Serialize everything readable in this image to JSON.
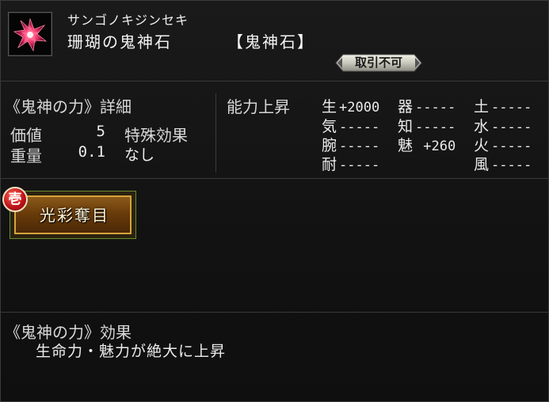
{
  "header": {
    "furigana": "サンゴノキジンセキ",
    "item_name": "珊瑚の鬼神石",
    "item_type": "【鬼神石】",
    "trade_status": "取引不可",
    "item_icon": "red-crystal-flower-icon"
  },
  "details": {
    "title": "《鬼神の力》詳細",
    "value_label": "価値",
    "value": "5",
    "special_effect_label": "特殊効果",
    "weight_label": "重量",
    "weight": "0.1",
    "special_effect_value": "なし"
  },
  "ability": {
    "title": "能力上昇",
    "stats": [
      {
        "name": "生",
        "value": "+2000"
      },
      {
        "name": "器",
        "value": "-----"
      },
      {
        "name": "土",
        "value": "-----"
      },
      {
        "name": "気",
        "value": "-----"
      },
      {
        "name": "知",
        "value": "-----"
      },
      {
        "name": "水",
        "value": "-----"
      },
      {
        "name": "腕",
        "value": "-----"
      },
      {
        "name": "魅",
        "value": " +260"
      },
      {
        "name": "火",
        "value": "-----"
      },
      {
        "name": "耐",
        "value": "-----"
      },
      {
        "name": "風",
        "value": "-----"
      }
    ]
  },
  "skill": {
    "rank_badge": "壱",
    "name": "光彩奪目"
  },
  "effect": {
    "title": "《鬼神の力》効果",
    "description": "生命力・魅力が絶大に上昇"
  },
  "colors": {
    "background": "#121212",
    "divider": "#3a3a3a",
    "skill_gold": "#d7a43a",
    "rank_red": "#c0141a"
  }
}
